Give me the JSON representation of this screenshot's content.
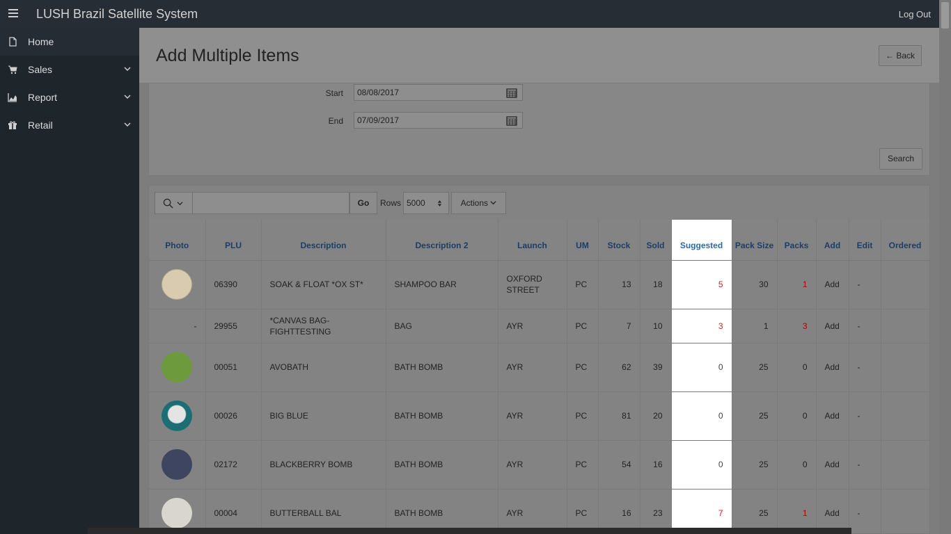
{
  "app": {
    "title": "LUSH Brazil Satellite System",
    "logout_label": "Log Out"
  },
  "sidebar": {
    "items": [
      {
        "label": "Home",
        "icon": "file-icon"
      },
      {
        "label": "Sales",
        "icon": "cart-icon"
      },
      {
        "label": "Report",
        "icon": "area-chart-icon"
      },
      {
        "label": "Retail",
        "icon": "gift-icon"
      }
    ]
  },
  "page": {
    "title": "Add Multiple Items",
    "back_label": "Back"
  },
  "filter": {
    "start_label": "Start",
    "start_value": "08/08/2017",
    "end_label": "End",
    "end_value": "07/09/2017",
    "search_label": "Search"
  },
  "toolbar": {
    "go_label": "Go",
    "rows_label": "Rows",
    "rows_value": "5000",
    "actions_label": "Actions"
  },
  "table": {
    "columns": [
      "Photo",
      "PLU",
      "Description",
      "Description 2",
      "Launch",
      "UM",
      "Stock",
      "Sold",
      "Suggested",
      "Pack Size",
      "Packs",
      "Add",
      "Edit",
      "Ordered"
    ],
    "rows": [
      {
        "photo": "-",
        "plu": "06390",
        "desc": "SOAK & FLOAT *OX ST*",
        "desc2": "SHAMPOO BAR",
        "launch": "OXFORD STREET",
        "um": "PC",
        "stock": "13",
        "sold": "18",
        "suggested": "5",
        "pack_size": "30",
        "packs": "1",
        "add": "Add",
        "edit": "-",
        "ordered": "",
        "photo_color": "#d8cbb0"
      },
      {
        "photo": "-",
        "plu": "29955",
        "desc": "*CANVAS BAG-FIGHTTESTING",
        "desc2": "BAG",
        "launch": "AYR",
        "um": "PC",
        "stock": "7",
        "sold": "10",
        "suggested": "3",
        "pack_size": "1",
        "packs": "3",
        "add": "Add",
        "edit": "-",
        "ordered": ""
      },
      {
        "photo": "-",
        "plu": "00051",
        "desc": "AVOBATH",
        "desc2": "BATH BOMB",
        "launch": "AYR",
        "um": "PC",
        "stock": "62",
        "sold": "39",
        "suggested": "0",
        "pack_size": "25",
        "packs": "0",
        "add": "Add",
        "edit": "-",
        "ordered": "",
        "photo_color": "#6c9a3c"
      },
      {
        "photo": "-",
        "plu": "00026",
        "desc": "BIG BLUE",
        "desc2": "BATH BOMB",
        "launch": "AYR",
        "um": "PC",
        "stock": "81",
        "sold": "20",
        "suggested": "0",
        "pack_size": "25",
        "packs": "0",
        "add": "Add",
        "edit": "-",
        "ordered": "",
        "photo_color": "#1a6e74"
      },
      {
        "photo": "-",
        "plu": "02172",
        "desc": "BLACKBERRY BOMB",
        "desc2": "BATH BOMB",
        "launch": "AYR",
        "um": "PC",
        "stock": "54",
        "sold": "16",
        "suggested": "0",
        "pack_size": "25",
        "packs": "0",
        "add": "Add",
        "edit": "-",
        "ordered": "",
        "photo_color": "#3d4560"
      },
      {
        "photo": "-",
        "plu": "00004",
        "desc": "BUTTERBALL BAL",
        "desc2": "BATH BOMB",
        "launch": "AYR",
        "um": "PC",
        "stock": "16",
        "sold": "23",
        "suggested": "7",
        "pack_size": "25",
        "packs": "1",
        "add": "Add",
        "edit": "-",
        "ordered": "",
        "photo_color": "#d9d6cf"
      }
    ]
  },
  "colors": {
    "topbar": "#262d34",
    "sidebar": "#1e252b",
    "highlight": "#ffffff",
    "link": "#1e4f86",
    "alert": "#d02020"
  }
}
